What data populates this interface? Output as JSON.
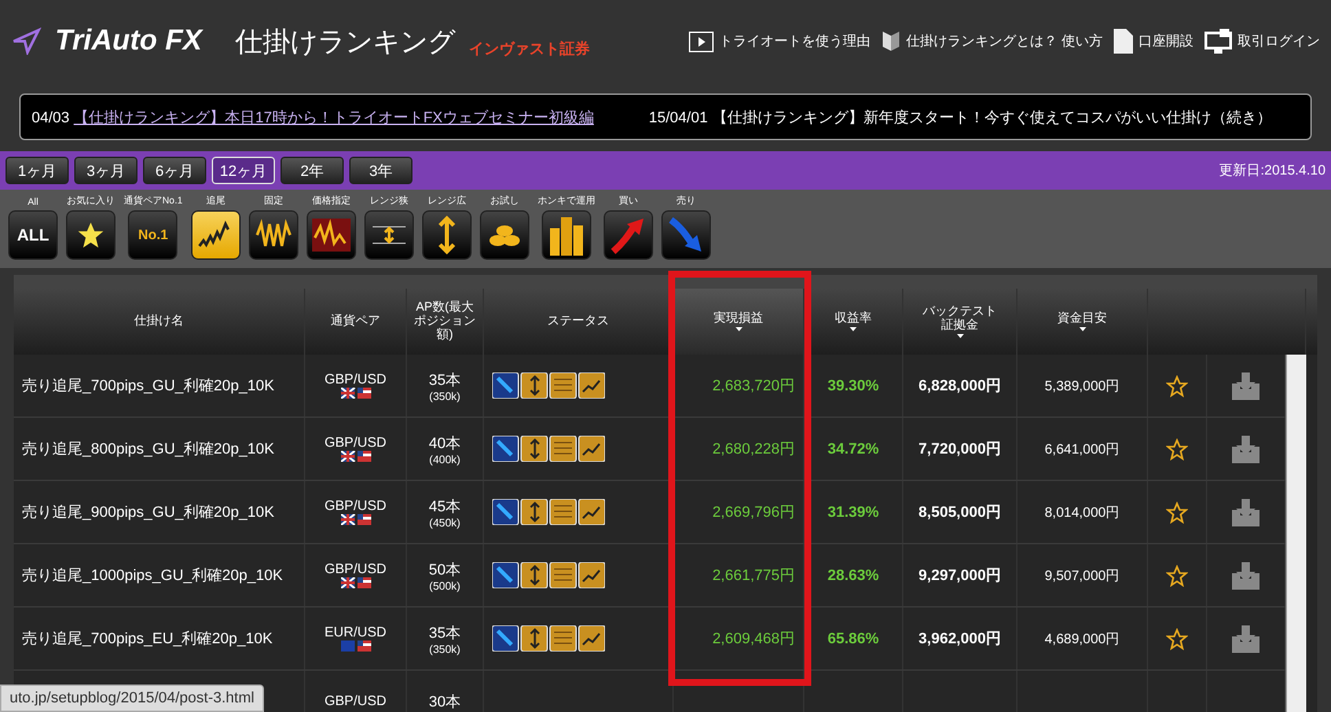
{
  "header": {
    "logo": "TriAuto FX",
    "title": "仕掛けランキング",
    "company": "インヴァスト証券",
    "nav": [
      {
        "kind": "film",
        "label": "トライオートを使う理由"
      },
      {
        "kind": "shield",
        "label": "仕掛けランキングとは？ 使い方"
      },
      {
        "kind": "doc",
        "label": "口座開設"
      },
      {
        "kind": "login",
        "label": "取引ログイン"
      }
    ]
  },
  "ticker": [
    {
      "date": "04/03",
      "text": "【仕掛けランキング】本日17時から！トライオートFXウェブセミナー初級編",
      "link": true
    },
    {
      "date": "15/04/01",
      "text": "【仕掛けランキング】新年度スタート！今すぐ使えてコスパがいい仕掛け（続き）",
      "link": false
    }
  ],
  "periods": [
    {
      "label": "1ヶ月",
      "selected": false
    },
    {
      "label": "3ヶ月",
      "selected": false
    },
    {
      "label": "6ヶ月",
      "selected": false
    },
    {
      "label": "12ヶ月",
      "selected": true
    },
    {
      "label": "2年",
      "selected": false
    },
    {
      "label": "3年",
      "selected": false
    }
  ],
  "updated": "更新日:2015.4.10",
  "filters": [
    {
      "label": "All",
      "kind": "all",
      "icon_text": "ALL",
      "selected": false
    },
    {
      "label": "お気に入り",
      "kind": "star",
      "selected": false
    },
    {
      "label": "通貨ペアNo.1",
      "kind": "no1",
      "icon_text": "No.1",
      "selected": false
    },
    {
      "label": "追尾",
      "kind": "trend",
      "selected": true
    },
    {
      "label": "固定",
      "kind": "wave",
      "selected": false
    },
    {
      "label": "価格指定",
      "kind": "price",
      "selected": false
    },
    {
      "label": "レンジ狭",
      "kind": "narrow",
      "selected": false
    },
    {
      "label": "レンジ広",
      "kind": "wide",
      "selected": false
    },
    {
      "label": "お試し",
      "kind": "coins",
      "selected": false
    },
    {
      "label": "ホンキで運用",
      "kind": "stack",
      "selected": false
    },
    {
      "label": "買い",
      "kind": "buy",
      "selected": false
    },
    {
      "label": "売り",
      "kind": "sell",
      "selected": false
    }
  ],
  "table": {
    "columns": [
      {
        "label": "仕掛け名",
        "highlighted": false,
        "sortable": false
      },
      {
        "label": "通貨ペア",
        "highlighted": false,
        "sortable": false
      },
      {
        "label": "AP数(最大ポジション額)",
        "highlighted": false,
        "sortable": false
      },
      {
        "label": "ステータス",
        "highlighted": false,
        "sortable": false
      },
      {
        "label": "実現損益",
        "highlighted": true,
        "sortable": true
      },
      {
        "label": "収益率",
        "highlighted": false,
        "sortable": true
      },
      {
        "label": "バックテスト証拠金",
        "highlighted": false,
        "sortable": true
      },
      {
        "label": "資金目安",
        "highlighted": false,
        "sortable": true
      }
    ],
    "rows": [
      {
        "name": "売り追尾_700pips_GU_利確20p_10K",
        "pair": "GBP/USD",
        "kind": "gb",
        "ap": "35本",
        "ap_sub": "(350k)",
        "profit": "2,683,720円",
        "rate": "39.30%",
        "backtest": "6,828,000円",
        "funds": "5,389,000円"
      },
      {
        "name": "売り追尾_800pips_GU_利確20p_10K",
        "pair": "GBP/USD",
        "kind": "gb",
        "ap": "40本",
        "ap_sub": "(400k)",
        "profit": "2,680,228円",
        "rate": "34.72%",
        "backtest": "7,720,000円",
        "funds": "6,641,000円"
      },
      {
        "name": "売り追尾_900pips_GU_利確20p_10K",
        "pair": "GBP/USD",
        "kind": "gb",
        "ap": "45本",
        "ap_sub": "(450k)",
        "profit": "2,669,796円",
        "rate": "31.39%",
        "backtest": "8,505,000円",
        "funds": "8,014,000円"
      },
      {
        "name": "売り追尾_1000pips_GU_利確20p_10K",
        "pair": "GBP/USD",
        "kind": "gb",
        "ap": "50本",
        "ap_sub": "(500k)",
        "profit": "2,661,775円",
        "rate": "28.63%",
        "backtest": "9,297,000円",
        "funds": "9,507,000円"
      },
      {
        "name": "売り追尾_700pips_EU_利確20p_10K",
        "pair": "EUR/USD",
        "kind": "eu",
        "ap": "35本",
        "ap_sub": "(350k)",
        "profit": "2,609,468円",
        "rate": "65.86%",
        "backtest": "3,962,000円",
        "funds": "4,689,000円"
      },
      {
        "pair": "GBP/USD",
        "ap": "30本"
      }
    ]
  },
  "status_url": "uto.jp/setupblog/2015/04/post-3.html"
}
